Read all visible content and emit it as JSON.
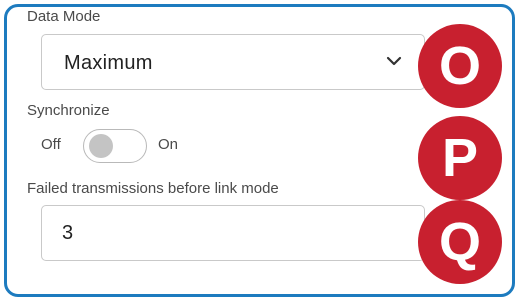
{
  "data_mode": {
    "label": "Data Mode",
    "selected_value": "Maximum",
    "dropdown_icon": "chevron-down-icon"
  },
  "synchronize": {
    "label": "Synchronize",
    "off_label": "Off",
    "on_label": "On",
    "state": "off"
  },
  "failed_transmissions": {
    "label": "Failed transmissions before link mode",
    "value": "3"
  },
  "markers": {
    "o": "O",
    "p": "P",
    "q": "Q"
  },
  "colors": {
    "frame_border": "#1d7bbf",
    "marker_fill": "#c8202f",
    "toggle_knob_off": "#c4c4c4"
  }
}
